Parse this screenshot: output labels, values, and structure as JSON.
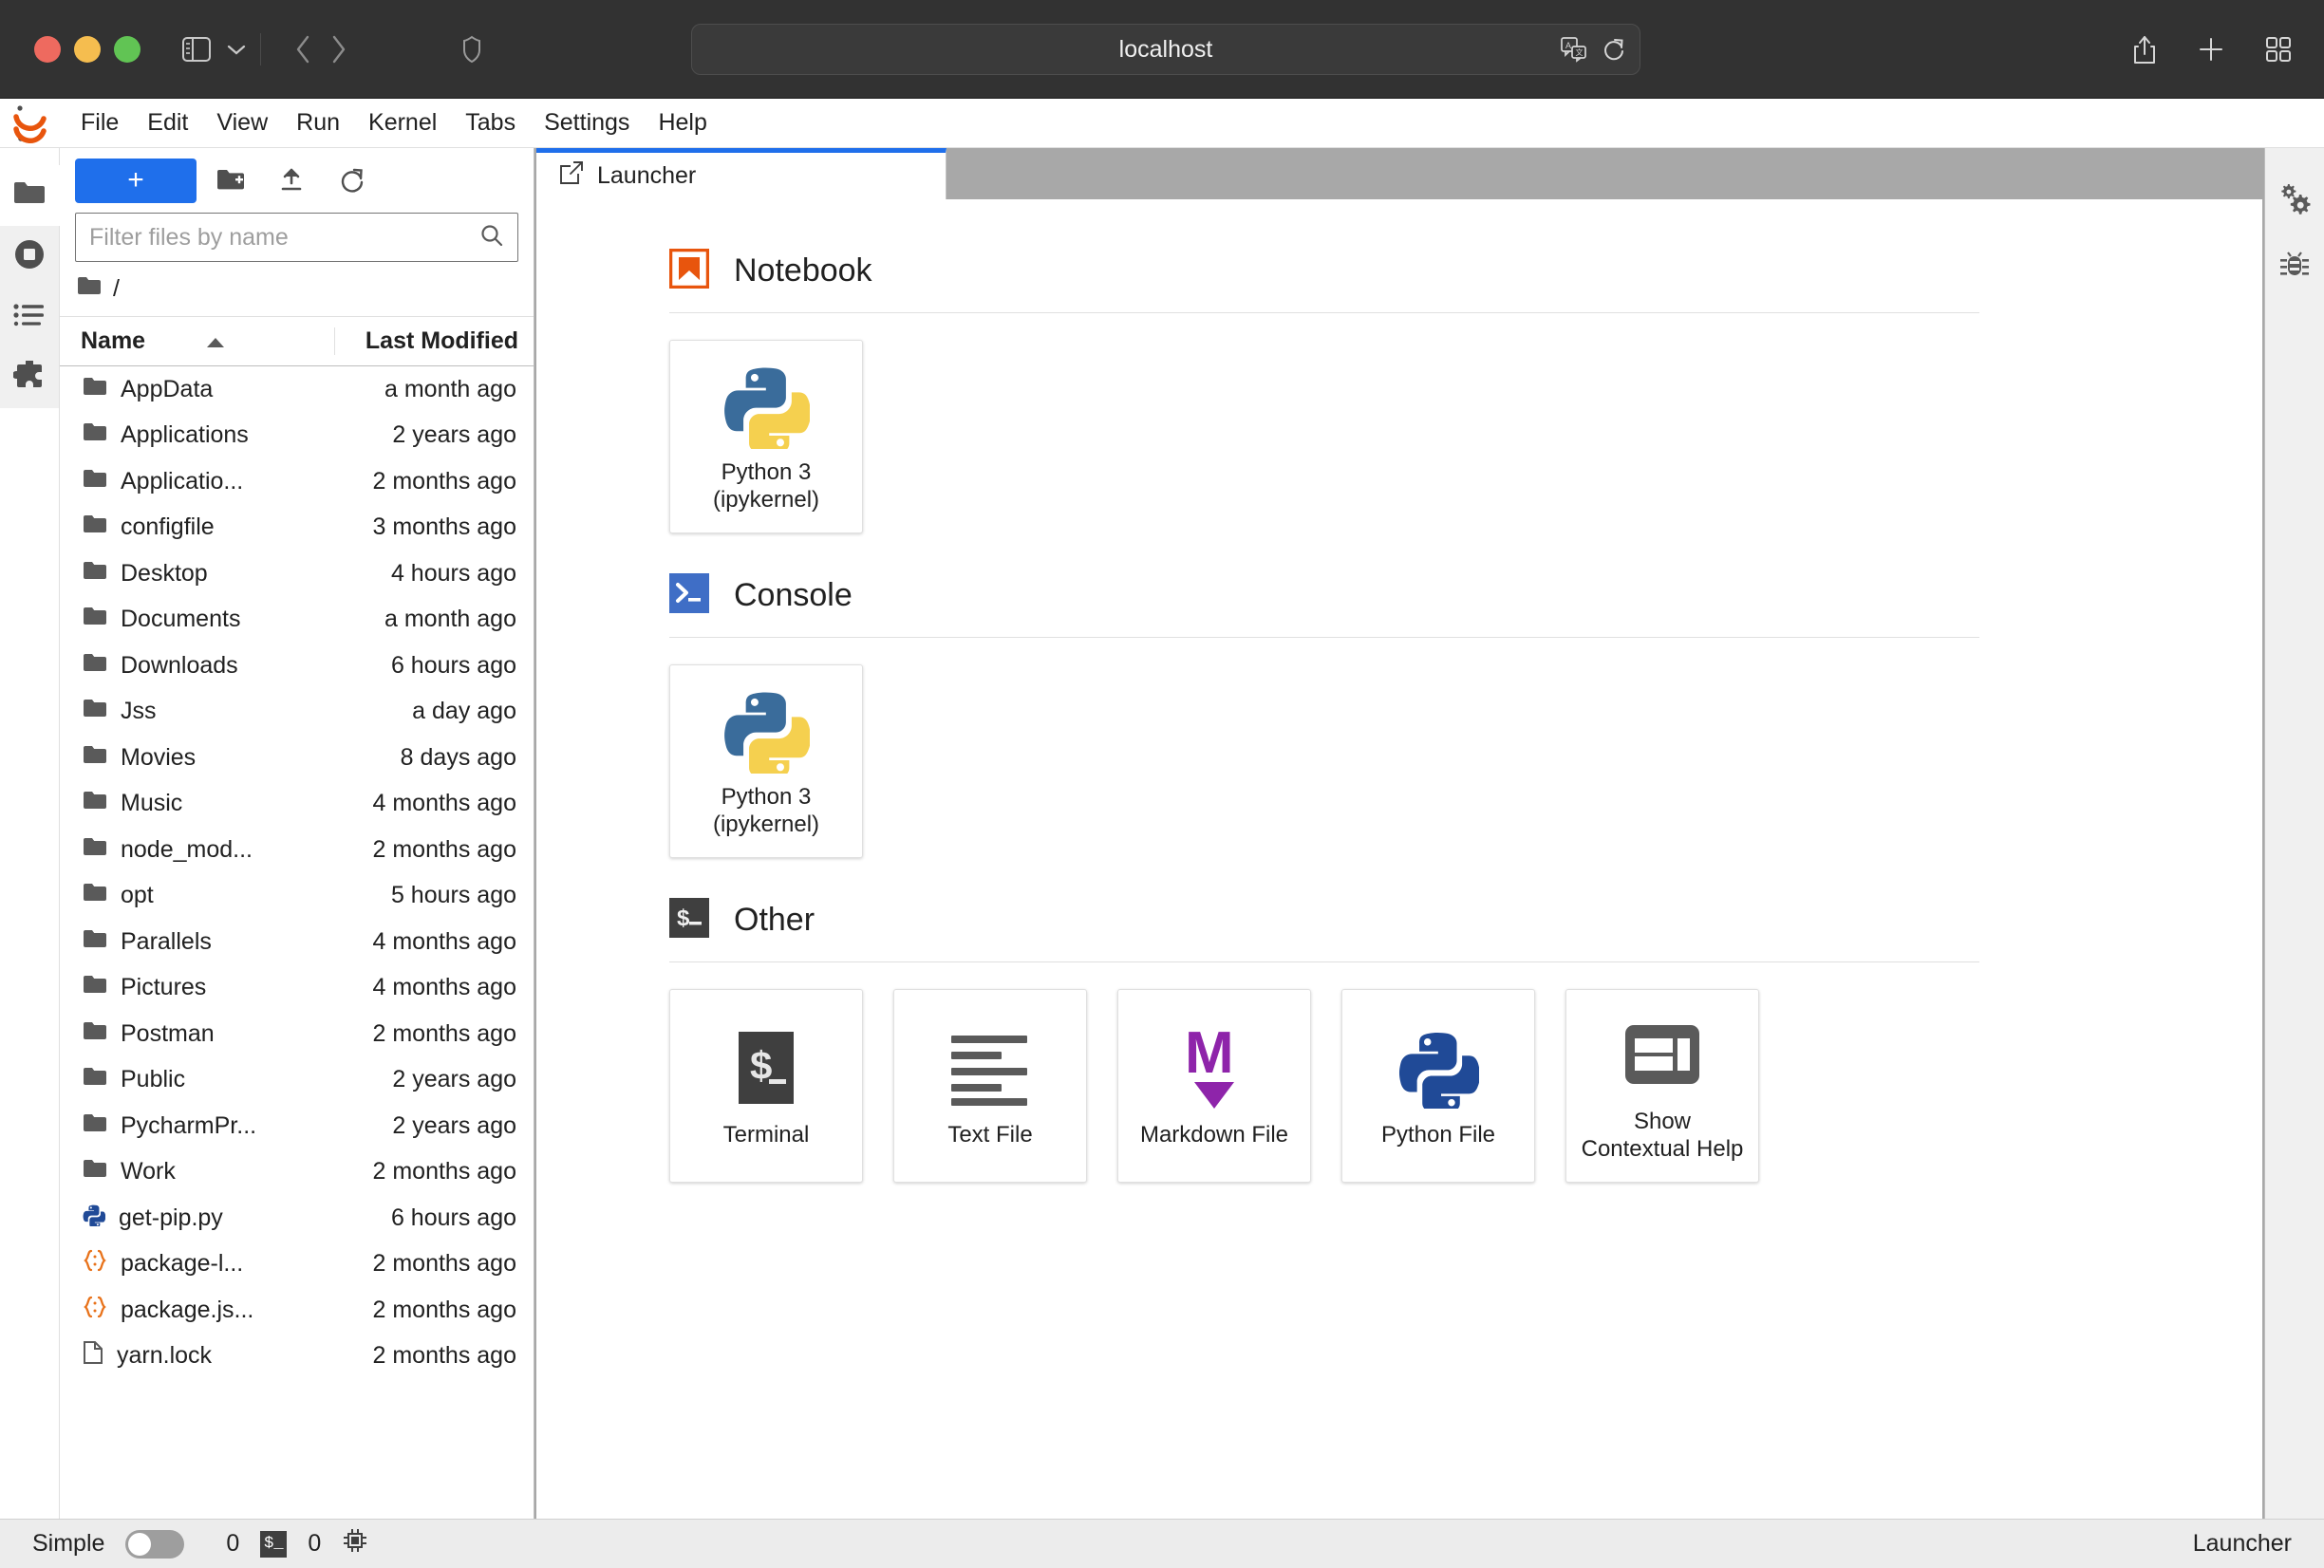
{
  "browser": {
    "url": "localhost",
    "icons": {
      "sidebar_toggle": "sidebar-toggle-icon",
      "tab_overview_chevron": "chevron-down-icon",
      "back": "back-arrow-icon",
      "forward": "forward-arrow-icon",
      "reader": "reader-shield-icon",
      "translate": "translate-icon",
      "reload": "reload-icon",
      "share": "share-icon",
      "new_tab": "plus-icon",
      "tab_overview": "tab-overview-icon"
    }
  },
  "menubar": {
    "logo": "jupyter-logo",
    "items": [
      "File",
      "Edit",
      "View",
      "Run",
      "Kernel",
      "Tabs",
      "Settings",
      "Help"
    ]
  },
  "activitybar": {
    "items": [
      {
        "name": "file-browser",
        "icon": "folder-icon",
        "active": false
      },
      {
        "name": "running-terminals-kernels",
        "icon": "stop-circle-icon",
        "active": true
      },
      {
        "name": "table-of-contents",
        "icon": "list-icon",
        "active": true
      },
      {
        "name": "extension-manager",
        "icon": "puzzle-icon",
        "active": true
      }
    ]
  },
  "filebrowser": {
    "toolbar": {
      "new_label": "+",
      "new_folder_icon": "new-folder-icon",
      "upload_icon": "upload-icon",
      "refresh_icon": "refresh-icon"
    },
    "filter": {
      "placeholder": "Filter files by name",
      "value": "",
      "search_icon": "search-icon"
    },
    "breadcrumb": "/",
    "columns": {
      "name": "Name",
      "last_modified": "Last Modified"
    },
    "sort_indicator": "sort-ascending-icon",
    "rows": [
      {
        "name": "AppData",
        "modified": "a month ago",
        "kind": "folder"
      },
      {
        "name": "Applications",
        "modified": "2 years ago",
        "kind": "folder"
      },
      {
        "name": "Applicatio...",
        "modified": "2 months ago",
        "kind": "folder"
      },
      {
        "name": "configfile",
        "modified": "3 months ago",
        "kind": "folder"
      },
      {
        "name": "Desktop",
        "modified": "4 hours ago",
        "kind": "folder"
      },
      {
        "name": "Documents",
        "modified": "a month ago",
        "kind": "folder"
      },
      {
        "name": "Downloads",
        "modified": "6 hours ago",
        "kind": "folder"
      },
      {
        "name": "Jss",
        "modified": "a day ago",
        "kind": "folder"
      },
      {
        "name": "Movies",
        "modified": "8 days ago",
        "kind": "folder"
      },
      {
        "name": "Music",
        "modified": "4 months ago",
        "kind": "folder"
      },
      {
        "name": "node_mod...",
        "modified": "2 months ago",
        "kind": "folder"
      },
      {
        "name": "opt",
        "modified": "5 hours ago",
        "kind": "folder"
      },
      {
        "name": "Parallels",
        "modified": "4 months ago",
        "kind": "folder"
      },
      {
        "name": "Pictures",
        "modified": "4 months ago",
        "kind": "folder"
      },
      {
        "name": "Postman",
        "modified": "2 months ago",
        "kind": "folder"
      },
      {
        "name": "Public",
        "modified": "2 years ago",
        "kind": "folder"
      },
      {
        "name": "PycharmPr...",
        "modified": "2 years ago",
        "kind": "folder"
      },
      {
        "name": "Work",
        "modified": "2 months ago",
        "kind": "folder"
      },
      {
        "name": "get-pip.py",
        "modified": "6 hours ago",
        "kind": "python"
      },
      {
        "name": "package-l...",
        "modified": "2 months ago",
        "kind": "json"
      },
      {
        "name": "package.js...",
        "modified": "2 months ago",
        "kind": "json"
      },
      {
        "name": "yarn.lock",
        "modified": "2 months ago",
        "kind": "file"
      }
    ]
  },
  "main": {
    "tab": {
      "label": "Launcher",
      "icon": "launcher-icon"
    },
    "sections": [
      {
        "title": "Notebook",
        "icon": "notebook-bookmark-icon",
        "cards": [
          {
            "label": "Python 3\n(ipykernel)",
            "icon": "python-logo-icon"
          }
        ]
      },
      {
        "title": "Console",
        "icon": "console-prompt-icon",
        "cards": [
          {
            "label": "Python 3\n(ipykernel)",
            "icon": "python-logo-icon"
          }
        ]
      },
      {
        "title": "Other",
        "icon": "terminal-dollar-icon",
        "cards": [
          {
            "label": "Terminal",
            "icon": "terminal-dollar-icon"
          },
          {
            "label": "Text File",
            "icon": "text-lines-icon"
          },
          {
            "label": "Markdown File",
            "icon": "markdown-m-icon"
          },
          {
            "label": "Python File",
            "icon": "python-mono-icon"
          },
          {
            "label": "Show\nContextual Help",
            "icon": "contextual-help-icon"
          }
        ]
      }
    ]
  },
  "rightbar": {
    "items": [
      {
        "name": "property-inspector",
        "icon": "gears-icon"
      },
      {
        "name": "debugger",
        "icon": "bug-icon"
      }
    ]
  },
  "statusbar": {
    "mode_label": "Simple",
    "mode_on": false,
    "kernel_count": "0",
    "terminal_icon": "terminal-badge-icon",
    "terminal_count": "0",
    "cpu_icon": "cpu-chip-icon",
    "active_item": "Launcher"
  },
  "colors": {
    "accent": "#1f6feb",
    "notebook_orange": "#e8550d",
    "console_blue": "#3f6ec6",
    "markdown_purple": "#8e24aa",
    "python_blue": "#2b5b84",
    "python_yellow": "#f6d55c",
    "terminal_dark": "#3f3f3f"
  }
}
